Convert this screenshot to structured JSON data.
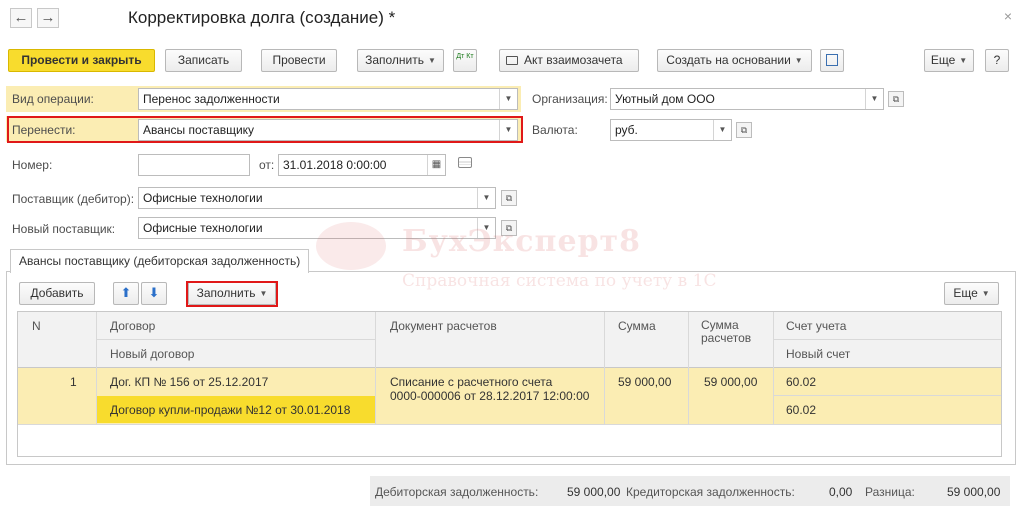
{
  "window": {
    "title": "Корректировка долга (создание) *",
    "back_glyph": "←",
    "forward_glyph": "→",
    "close_glyph": "×"
  },
  "toolbar": {
    "post_close": "Провести и закрыть",
    "save": "Записать",
    "post": "Провести",
    "fill": "Заполнить",
    "dt_kt": "Дт Кт",
    "act": "Акт взаимозачета",
    "create_based": "Создать на основании",
    "more": "Еще",
    "help": "?"
  },
  "form": {
    "operation_label": "Вид операции:",
    "operation_value": "Перенос задолженности",
    "transfer_label": "Перенести:",
    "transfer_value": "Авансы поставщику",
    "number_label": "Номер:",
    "number_value": "",
    "from_label": "от:",
    "date_value": "31.01.2018  0:00:00",
    "supplier_label": "Поставщик (дебитор):",
    "supplier_value": "Офисные технологии",
    "new_supplier_label": "Новый поставщик:",
    "new_supplier_value": "Офисные технологии",
    "org_label": "Организация:",
    "org_value": "Уютный дом ООО",
    "currency_label": "Валюта:",
    "currency_value": "руб."
  },
  "watermark": {
    "title": "БухЭксперт8",
    "subtitle": "Справочная система по учету в 1С"
  },
  "tab": {
    "label": "Авансы поставщику (дебиторская задолженность)",
    "add": "Добавить",
    "fill": "Заполнить",
    "more": "Еще"
  },
  "table": {
    "headers": {
      "n": "N",
      "contract": "Договор",
      "new_contract": "Новый договор",
      "doc": "Документ расчетов",
      "sum": "Сумма",
      "sum_settle": "Сумма расчетов",
      "account": "Счет учета",
      "new_account": "Новый счет"
    },
    "rows": [
      {
        "n": "1",
        "contract": "Дог. КП № 156 от 25.12.2017",
        "new_contract": "Договор купли-продажи №12 от 30.01.2018",
        "doc_line1": "Списание с расчетного счета",
        "doc_line2": "0000-000006 от 28.12.2017 12:00:00",
        "sum": "59 000,00",
        "sum_settle": "59 000,00",
        "account": "60.02",
        "new_account": "60.02"
      }
    ]
  },
  "footer": {
    "debit_label": "Дебиторская задолженность:",
    "debit_value": "59 000,00",
    "credit_label": "Кредиторская задолженность:",
    "credit_value": "0,00",
    "diff_label": "Разница:",
    "diff_value": "59 000,00"
  },
  "colors": {
    "primary_button": "#f8dc2d",
    "row_highlight": "#fbedb3",
    "cell_selected": "#f8dc2d",
    "red_frame": "#e01818"
  }
}
